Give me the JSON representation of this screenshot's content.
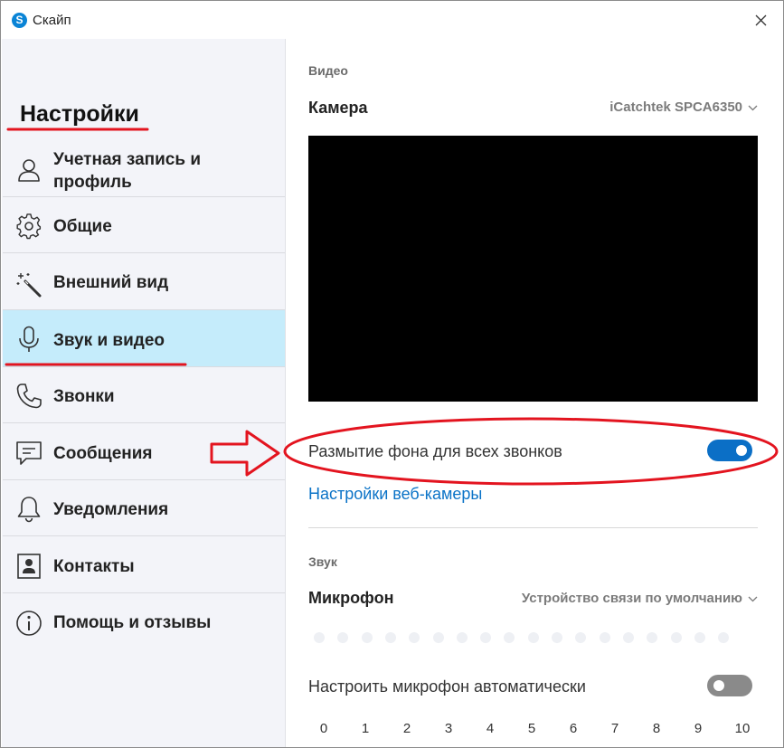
{
  "window": {
    "title": "Скайп"
  },
  "sidebar": {
    "title": "Настройки",
    "items": [
      {
        "label_1": "Учетная запись и",
        "label_2": "профиль",
        "icon": "person-icon"
      },
      {
        "label": "Общие",
        "icon": "gear-icon"
      },
      {
        "label": "Внешний вид",
        "icon": "magic-wand-icon"
      },
      {
        "label": "Звук и видео",
        "icon": "microphone-icon",
        "active": true
      },
      {
        "label": "Звонки",
        "icon": "phone-icon"
      },
      {
        "label": "Сообщения",
        "icon": "chat-icon"
      },
      {
        "label": "Уведомления",
        "icon": "bell-icon"
      },
      {
        "label": "Контакты",
        "icon": "contact-card-icon"
      },
      {
        "label": "Помощь и отзывы",
        "icon": "info-icon"
      }
    ]
  },
  "video": {
    "section_label": "Видео",
    "camera_label": "Камера",
    "camera_device": "iCatchtek SPCA6350",
    "blur_label": "Размытие фона для всех звонков",
    "blur_enabled": true,
    "webcam_settings_link": "Настройки веб-камеры"
  },
  "audio": {
    "section_label": "Звук",
    "mic_label": "Микрофон",
    "mic_device": "Устройство связи по умолчанию",
    "auto_mic_label": "Настроить микрофон автоматически",
    "auto_mic_enabled": false,
    "scale": [
      "0",
      "1",
      "2",
      "3",
      "4",
      "5",
      "6",
      "7",
      "8",
      "9",
      "10"
    ]
  },
  "colors": {
    "accent": "#0b6fc6",
    "link": "#0b73c7",
    "active_item_bg": "#c5ecfb",
    "annotation": "#e3141f"
  }
}
